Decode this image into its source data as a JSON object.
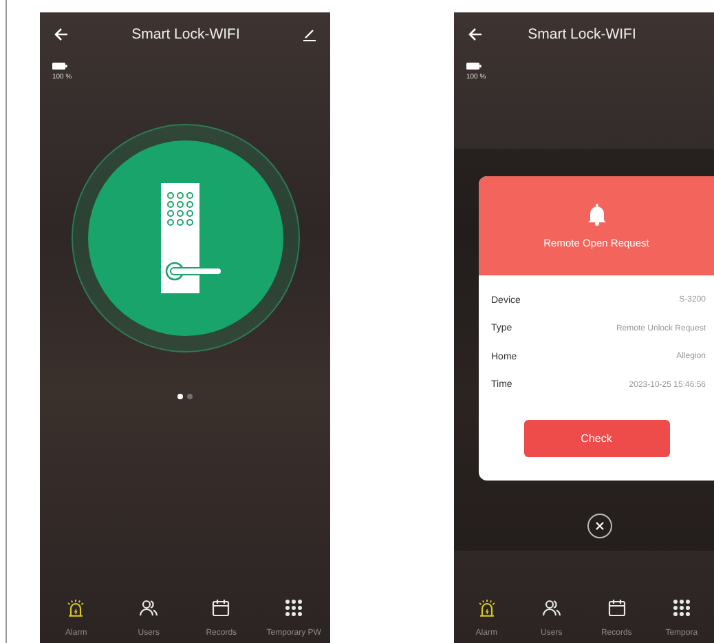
{
  "left_screen": {
    "header": {
      "title": "Smart Lock-WIFI"
    },
    "battery": "100 %",
    "pager": [
      {
        "selected": true
      },
      {
        "selected": false
      }
    ],
    "nav": [
      {
        "kind": "alarm",
        "label": "Alarm",
        "selected": true
      },
      {
        "kind": "users",
        "label": "Users",
        "selected": false
      },
      {
        "kind": "records",
        "label": "Records",
        "selected": false
      },
      {
        "kind": "temporary_pw",
        "label": "Temporary PW",
        "selected": false
      }
    ]
  },
  "right_screen": {
    "header": {
      "title": "Smart Lock-WIFI"
    },
    "battery": "100 %",
    "dialog": {
      "title": "Remote Open Request",
      "rows": [
        {
          "label": "Device",
          "value": "S-3200"
        },
        {
          "label": "Type",
          "value": "Remote Unlock Request"
        },
        {
          "label": "Home",
          "value": "Allegion"
        },
        {
          "label": "Time",
          "value": "2023-10-25 15:46:56"
        }
      ],
      "button": "Check"
    },
    "nav": [
      {
        "kind": "alarm",
        "label": "Alarm",
        "selected": true
      },
      {
        "kind": "users",
        "label": "Users",
        "selected": false
      },
      {
        "kind": "records",
        "label": "Records",
        "selected": false
      },
      {
        "kind": "temporary_pw",
        "label": "Tempora",
        "selected": false
      }
    ]
  }
}
